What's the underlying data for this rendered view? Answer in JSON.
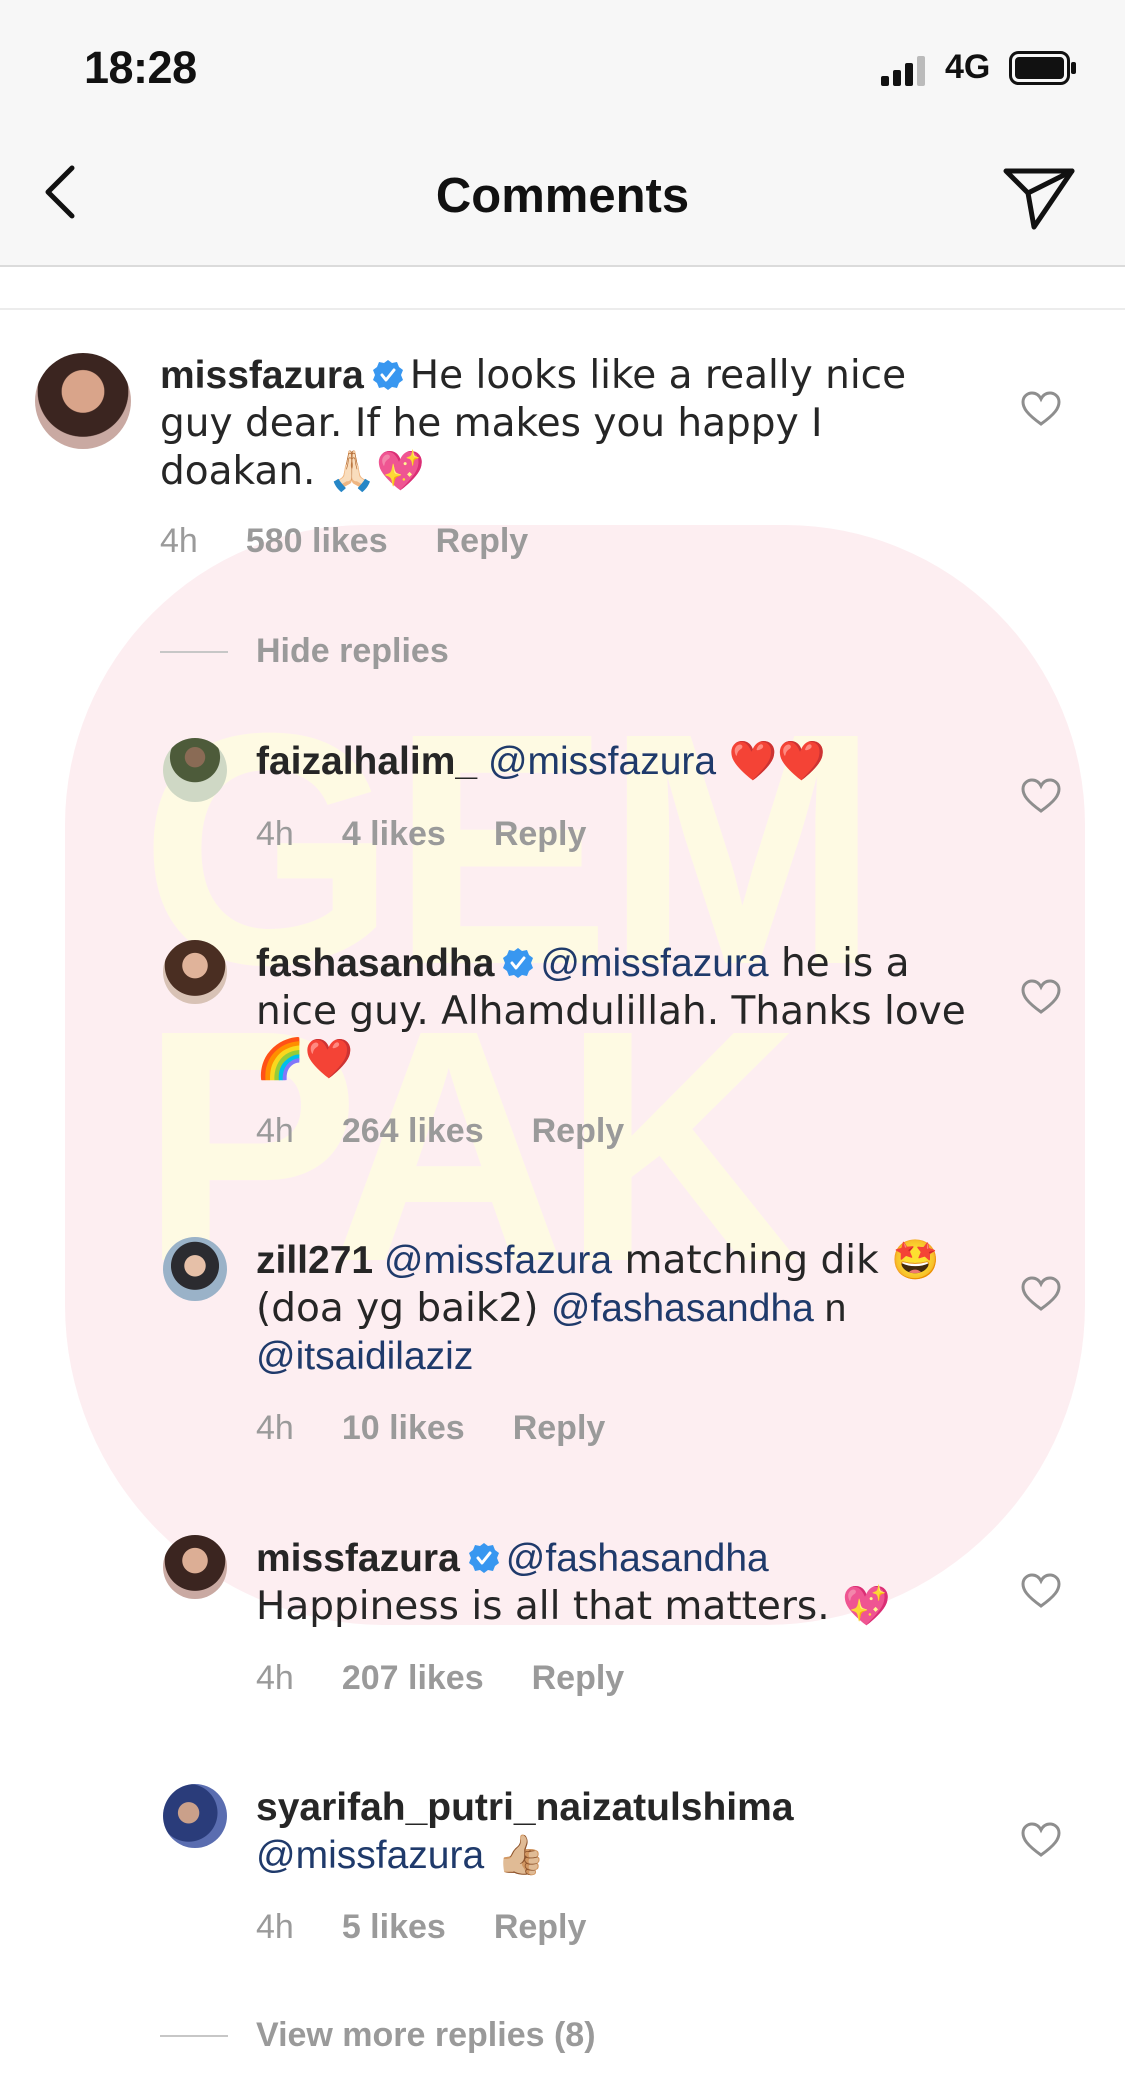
{
  "status_bar": {
    "time": "18:28",
    "network": "4G"
  },
  "header": {
    "title": "Comments"
  },
  "main_comment": {
    "username": "missfazura",
    "text": "He looks like a really nice guy dear. If he makes you happy I doakan. 🙏🏻💖",
    "age": "4h",
    "likes": "580 likes",
    "reply_label": "Reply"
  },
  "hide_replies_label": "Hide replies",
  "replies": [
    {
      "username": "faizalhalim_",
      "mention": "@missfazura",
      "text": " ❤️❤️",
      "age": "4h",
      "likes": "4 likes",
      "reply_label": "Reply"
    },
    {
      "username": "fashasandha",
      "mention": "@missfazura",
      "text": " he is a nice guy. Alhamdulillah. Thanks love 🌈❤️",
      "age": "4h",
      "likes": "264 likes",
      "reply_label": "Reply"
    },
    {
      "username": "zill271",
      "mention": "@missfazura",
      "text_a": " matching dik 🤩 (doa yg baik2) ",
      "mention2": "@fashasandha",
      "text_b": " n ",
      "mention3": "@itsaidilaziz",
      "age": "4h",
      "likes": "10 likes",
      "reply_label": "Reply"
    },
    {
      "username": "missfazura",
      "mention": "@fashasandha",
      "text": " Happiness is all that matters. 💖",
      "age": "4h",
      "likes": "207 likes",
      "reply_label": "Reply"
    },
    {
      "username": "syarifah_putri_naizatulshima",
      "mention": "@missfazura",
      "text": " 👍🏼",
      "age": "4h",
      "likes": "5 likes",
      "reply_label": "Reply"
    }
  ],
  "view_more_label": "View more replies (8)",
  "watermark": "GEM PAK",
  "colors": {
    "mention": "#1f3a6b",
    "meta": "#9a9a9a",
    "verified": "#3897f0",
    "watermark_bg": "#fdeef1"
  }
}
